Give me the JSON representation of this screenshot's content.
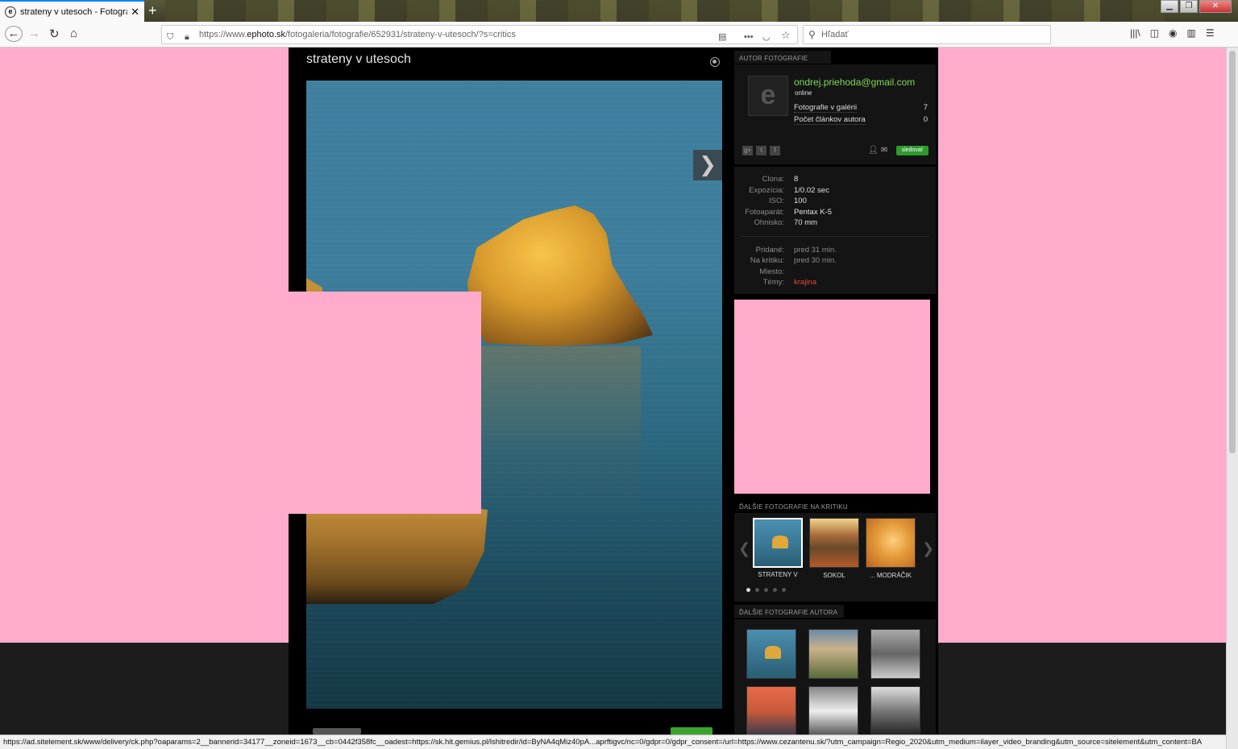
{
  "browser": {
    "tab_title": "strateny v utesoch - Fotografia",
    "url_prefix": "https://www.",
    "url_domain": "ephoto.sk",
    "url_path": "/fotogaleria/fotografie/652931/strateny-v-utesoch/?s=critics",
    "search_placeholder": "Hľadať",
    "status_url": "https://ad.sitelement.sk/www/delivery/ck.php?oaparams=2__bannerid=34177__zoneid=1673__cb=0442f358fc__oadest=https://sk.hit.gemius.pl/lshitredir/id=ByNA4qMiz40pA...aprftigvc/nc=0/gdpr=0/gdpr_consent=/url=https://www.cezantenu.sk/?utm_campaign=Regio_2020&utm_medium=ilayer_video_branding&utm_source=sitelement&utm_content=BA"
  },
  "photo": {
    "title": "strateny v utesoch",
    "next_icon": "chevron-right-icon"
  },
  "author": {
    "section_title": "AUTOR FOTOGRAFIE",
    "name": "ondrej.priehoda@gmail.com",
    "status": "online",
    "stats": [
      {
        "label": "Fotografie v galérii",
        "value": "7"
      },
      {
        "label": "Počet článkov autora",
        "value": "0"
      }
    ],
    "social": [
      "google-plus-icon",
      "twitter-icon",
      "facebook-icon"
    ],
    "follow_label": "sledovať"
  },
  "exif": [
    {
      "label": "Clona:",
      "value": "8"
    },
    {
      "label": "Expozícia:",
      "value": "1/0.02 sec"
    },
    {
      "label": "ISO:",
      "value": "100"
    },
    {
      "label": "Fotoaparát:",
      "value": "Pentax K-5"
    },
    {
      "label": "Ohnisko:",
      "value": "70 mm"
    }
  ],
  "meta": [
    {
      "label": "Pridané:",
      "value": "pred 31 min."
    },
    {
      "label": "Na kritiku:",
      "value": "pred 30 min."
    },
    {
      "label": "Miesto:",
      "value": ""
    },
    {
      "label": "Témy:",
      "value": "krajina"
    }
  ],
  "critique": {
    "section_title": "ĎALŠIE FOTOGRAFIE NA KRITIKU",
    "items": [
      {
        "label": "STRATENY V",
        "selected": true
      },
      {
        "label": "SOKOL",
        "selected": false
      },
      {
        "label": "... MODRÁČIK",
        "selected": false
      }
    ]
  },
  "more_author": {
    "section_title": "ĎALŠIE FOTOGRAFIE AUTORA"
  },
  "colors": {
    "accent_green": "#7ed957",
    "tag_red": "#e04a3a",
    "ad_pink": "#ffabcc"
  }
}
